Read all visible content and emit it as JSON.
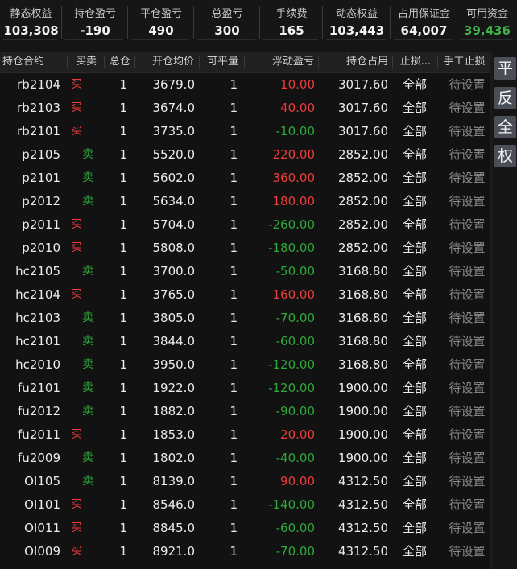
{
  "summary": [
    {
      "label": "静态权益",
      "value": "103,308",
      "tone": "white"
    },
    {
      "label": "持仓盈亏",
      "value": "-190",
      "tone": "white"
    },
    {
      "label": "平仓盈亏",
      "value": "490",
      "tone": "white"
    },
    {
      "label": "总盈亏",
      "value": "300",
      "tone": "white"
    },
    {
      "label": "手续费",
      "value": "165",
      "tone": "white"
    },
    {
      "label": "动态权益",
      "value": "103,443",
      "tone": "white"
    },
    {
      "label": "占用保证金",
      "value": "64,007",
      "tone": "white"
    },
    {
      "label": "可用资金",
      "value": "39,436",
      "tone": "green"
    }
  ],
  "table": {
    "headers": {
      "contract": "持仓合约",
      "side": "买卖",
      "total": "总仓",
      "avg_price": "开仓均价",
      "closable": "可平量",
      "float_pnl": "浮动盈亏",
      "margin": "持仓占用",
      "stop": "止损...",
      "manual_stop": "手工止损"
    },
    "rows": [
      {
        "contract": "rb2104",
        "side": "买",
        "total": "1",
        "avg_price": "3679.0",
        "closable": "1",
        "float_pnl": "10.00",
        "margin": "3017.60",
        "stop": "全部",
        "manual_stop": "待设置"
      },
      {
        "contract": "rb2103",
        "side": "买",
        "total": "1",
        "avg_price": "3674.0",
        "closable": "1",
        "float_pnl": "40.00",
        "margin": "3017.60",
        "stop": "全部",
        "manual_stop": "待设置"
      },
      {
        "contract": "rb2101",
        "side": "买",
        "total": "1",
        "avg_price": "3735.0",
        "closable": "1",
        "float_pnl": "-10.00",
        "margin": "3017.60",
        "stop": "全部",
        "manual_stop": "待设置"
      },
      {
        "contract": "p2105",
        "side": "卖",
        "total": "1",
        "avg_price": "5520.0",
        "closable": "1",
        "float_pnl": "220.00",
        "margin": "2852.00",
        "stop": "全部",
        "manual_stop": "待设置"
      },
      {
        "contract": "p2101",
        "side": "卖",
        "total": "1",
        "avg_price": "5602.0",
        "closable": "1",
        "float_pnl": "360.00",
        "margin": "2852.00",
        "stop": "全部",
        "manual_stop": "待设置"
      },
      {
        "contract": "p2012",
        "side": "卖",
        "total": "1",
        "avg_price": "5634.0",
        "closable": "1",
        "float_pnl": "180.00",
        "margin": "2852.00",
        "stop": "全部",
        "manual_stop": "待设置"
      },
      {
        "contract": "p2011",
        "side": "买",
        "total": "1",
        "avg_price": "5704.0",
        "closable": "1",
        "float_pnl": "-260.00",
        "margin": "2852.00",
        "stop": "全部",
        "manual_stop": "待设置"
      },
      {
        "contract": "p2010",
        "side": "买",
        "total": "1",
        "avg_price": "5808.0",
        "closable": "1",
        "float_pnl": "-180.00",
        "margin": "2852.00",
        "stop": "全部",
        "manual_stop": "待设置"
      },
      {
        "contract": "hc2105",
        "side": "卖",
        "total": "1",
        "avg_price": "3700.0",
        "closable": "1",
        "float_pnl": "-50.00",
        "margin": "3168.80",
        "stop": "全部",
        "manual_stop": "待设置"
      },
      {
        "contract": "hc2104",
        "side": "买",
        "total": "1",
        "avg_price": "3765.0",
        "closable": "1",
        "float_pnl": "160.00",
        "margin": "3168.80",
        "stop": "全部",
        "manual_stop": "待设置"
      },
      {
        "contract": "hc2103",
        "side": "卖",
        "total": "1",
        "avg_price": "3805.0",
        "closable": "1",
        "float_pnl": "-70.00",
        "margin": "3168.80",
        "stop": "全部",
        "manual_stop": "待设置"
      },
      {
        "contract": "hc2101",
        "side": "卖",
        "total": "1",
        "avg_price": "3844.0",
        "closable": "1",
        "float_pnl": "-60.00",
        "margin": "3168.80",
        "stop": "全部",
        "manual_stop": "待设置"
      },
      {
        "contract": "hc2010",
        "side": "卖",
        "total": "1",
        "avg_price": "3950.0",
        "closable": "1",
        "float_pnl": "-120.00",
        "margin": "3168.80",
        "stop": "全部",
        "manual_stop": "待设置"
      },
      {
        "contract": "fu2101",
        "side": "卖",
        "total": "1",
        "avg_price": "1922.0",
        "closable": "1",
        "float_pnl": "-120.00",
        "margin": "1900.00",
        "stop": "全部",
        "manual_stop": "待设置"
      },
      {
        "contract": "fu2012",
        "side": "卖",
        "total": "1",
        "avg_price": "1882.0",
        "closable": "1",
        "float_pnl": "-90.00",
        "margin": "1900.00",
        "stop": "全部",
        "manual_stop": "待设置"
      },
      {
        "contract": "fu2011",
        "side": "买",
        "total": "1",
        "avg_price": "1853.0",
        "closable": "1",
        "float_pnl": "20.00",
        "margin": "1900.00",
        "stop": "全部",
        "manual_stop": "待设置"
      },
      {
        "contract": "fu2009",
        "side": "卖",
        "total": "1",
        "avg_price": "1802.0",
        "closable": "1",
        "float_pnl": "-40.00",
        "margin": "1900.00",
        "stop": "全部",
        "manual_stop": "待设置"
      },
      {
        "contract": "OI105",
        "side": "卖",
        "total": "1",
        "avg_price": "8139.0",
        "closable": "1",
        "float_pnl": "90.00",
        "margin": "4312.50",
        "stop": "全部",
        "manual_stop": "待设置"
      },
      {
        "contract": "OI101",
        "side": "买",
        "total": "1",
        "avg_price": "8546.0",
        "closable": "1",
        "float_pnl": "-140.00",
        "margin": "4312.50",
        "stop": "全部",
        "manual_stop": "待设置"
      },
      {
        "contract": "OI011",
        "side": "买",
        "total": "1",
        "avg_price": "8845.0",
        "closable": "1",
        "float_pnl": "-60.00",
        "margin": "4312.50",
        "stop": "全部",
        "manual_stop": "待设置"
      },
      {
        "contract": "OI009",
        "side": "买",
        "total": "1",
        "avg_price": "8921.0",
        "closable": "1",
        "float_pnl": "-70.00",
        "margin": "4312.50",
        "stop": "全部",
        "manual_stop": "待设置"
      }
    ]
  },
  "side_buttons": [
    "平",
    "反",
    "全",
    "权"
  ],
  "colors": {
    "buy": "#ee3b3b",
    "sell": "#2ea83a",
    "profit": "#ee3b3b",
    "loss": "#2ea83a",
    "available_funds": "#3fb44a"
  }
}
